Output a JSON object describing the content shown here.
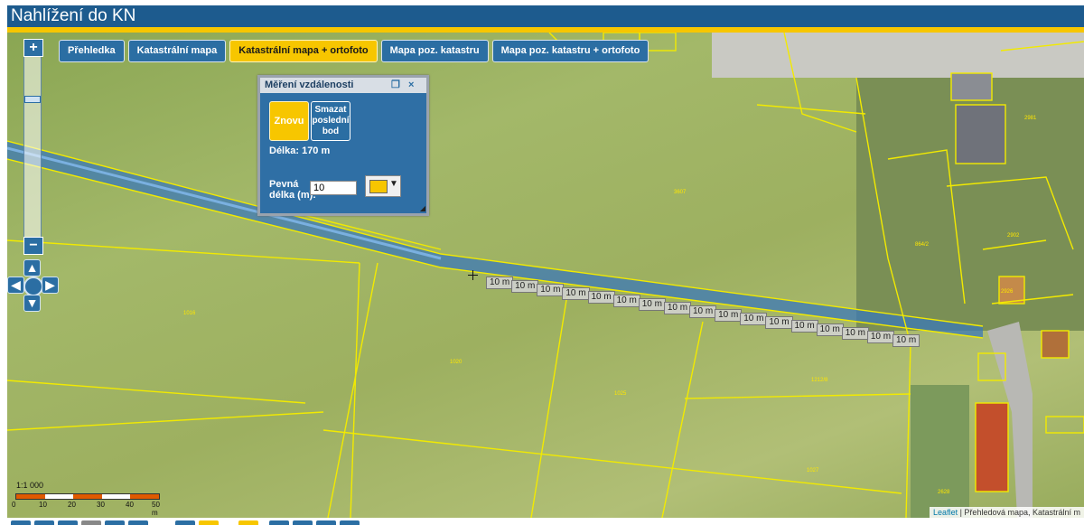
{
  "app": {
    "title": "Nahlížení do KN"
  },
  "tabs": [
    {
      "label": "Přehledka",
      "active": false
    },
    {
      "label": "Katastrální mapa",
      "active": false
    },
    {
      "label": "Katastrální mapa + ortofoto",
      "active": true
    },
    {
      "label": "Mapa poz. katastru",
      "active": false
    },
    {
      "label": "Mapa poz. katastru + ortofoto",
      "active": false
    }
  ],
  "zoom": {
    "in_label": "+",
    "out_label": "−"
  },
  "pan": {
    "up": "▲",
    "down": "▼",
    "left": "◀",
    "right": "▶"
  },
  "measure_panel": {
    "title": "Měření vzdálenosti",
    "again_label": "Znovu",
    "delete_last_label": "Smazat\nposlední\nbod",
    "length_text": "Délka: 170 m",
    "fixed_length_label": "Pevná\ndélka (m):",
    "fixed_length_value": "10",
    "line_color": "#f7c600"
  },
  "segment_label": "10 m",
  "segment_count": 17,
  "parcel_numbers": [
    "3607",
    "864/2",
    "1016",
    "1020",
    "1025",
    "1212/8",
    "1027",
    "2981",
    "2902",
    "2926",
    "2628"
  ],
  "scale": {
    "ratio": "1:1 000",
    "ticks": [
      "0",
      "10",
      "20",
      "30",
      "40",
      "50 m"
    ]
  },
  "attribution": {
    "leaflet": "Leaflet",
    "text": "| Přehledová mapa, Katastrální m"
  },
  "colors": {
    "brand": "#1d5b8e",
    "accent": "#f7c600",
    "parcel_lines": "#f2ea00"
  }
}
